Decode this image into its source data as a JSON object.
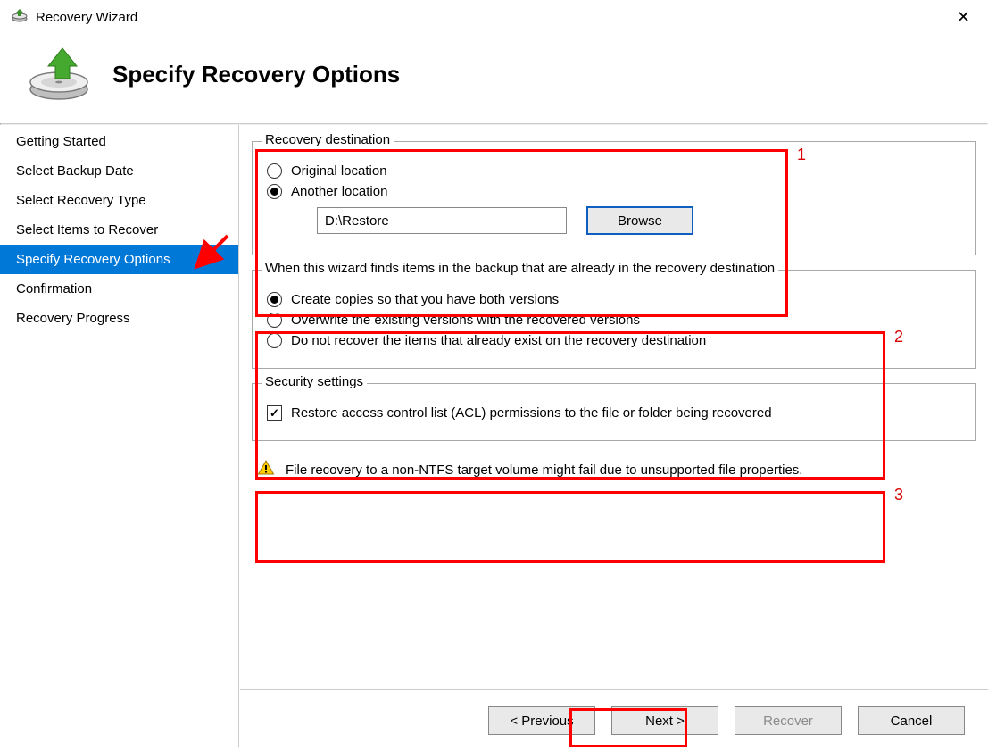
{
  "window": {
    "title": "Recovery Wizard",
    "heading": "Specify Recovery Options"
  },
  "sidebar": {
    "items": [
      {
        "label": "Getting Started",
        "selected": false
      },
      {
        "label": "Select Backup Date",
        "selected": false
      },
      {
        "label": "Select Recovery Type",
        "selected": false
      },
      {
        "label": "Select Items to Recover",
        "selected": false
      },
      {
        "label": "Specify Recovery Options",
        "selected": true
      },
      {
        "label": "Confirmation",
        "selected": false
      },
      {
        "label": "Recovery Progress",
        "selected": false
      }
    ]
  },
  "groups": {
    "destination": {
      "legend": "Recovery destination",
      "options": {
        "original": "Original location",
        "another": "Another location"
      },
      "selected": "another",
      "path": "D:\\Restore",
      "browse": "Browse"
    },
    "collision": {
      "legend": "When this wizard finds items in the backup that are already in the recovery destination",
      "options": {
        "copies": "Create copies so that you have both versions",
        "overwrite": "Overwrite the existing versions with the recovered versions",
        "skip": "Do not recover the items that already exist on the recovery destination"
      },
      "selected": "copies"
    },
    "security": {
      "legend": "Security settings",
      "acl_label": "Restore access control list (ACL) permissions to the file or folder being recovered",
      "acl_checked": true
    }
  },
  "warning": "File recovery to a non-NTFS target volume might fail due to unsupported file properties.",
  "buttons": {
    "previous": "< Previous",
    "next": "Next >",
    "recover": "Recover",
    "cancel": "Cancel"
  },
  "annotations": {
    "1": "1",
    "2": "2",
    "3": "3"
  }
}
